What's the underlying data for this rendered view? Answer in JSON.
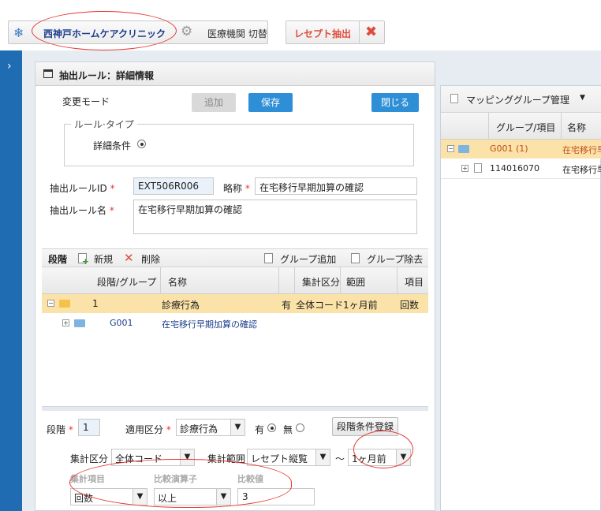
{
  "topbar": {
    "clinic_name": "西神戸ホームケアクリニック",
    "switch_label": "医療機関 切替",
    "receipt_label": "レセプト抽出"
  },
  "panel_title": "抽出ルール：詳細情報",
  "form": {
    "mode_label": "変更モード",
    "add_label": "追加",
    "save_label": "保存",
    "close_label": "閉じる",
    "rule_type_legend": "ルール·タイプ",
    "detail_condition_label": "詳細条件",
    "rule_id_label": "抽出ルールID",
    "rule_id_value": "EXT506R006",
    "short_name_label": "略称",
    "short_name_value": "在宅移行早期加算の確認",
    "rule_name_label": "抽出ルール名",
    "rule_name_value": "在宅移行早期加算の確認",
    "required_mark": "*"
  },
  "stage_toolbar": {
    "title": "段階",
    "new_label": "新規",
    "delete_label": "削除",
    "group_add_label": "グループ追加",
    "group_remove_label": "グループ除去"
  },
  "stage_grid": {
    "headers": [
      "段階/グループ",
      "名称",
      "",
      "集計区分",
      "範囲",
      "項目"
    ],
    "rows": [
      {
        "stage": "1",
        "name": "診療行為",
        "flag": "有",
        "agg": "全体コード",
        "range": "1ヶ月前",
        "item": "回数"
      },
      {
        "stage": "G001",
        "name": "在宅移行早期加算の確認",
        "flag": "",
        "agg": "",
        "range": "",
        "item": ""
      }
    ]
  },
  "stage_form": {
    "stage_label": "段階",
    "stage_value": "1",
    "apply_label": "適用区分",
    "apply_value": "診療行為",
    "yes_label": "有",
    "no_label": "無",
    "register_label": "段階条件登録",
    "agg_label": "集計区分",
    "agg_value": "全体コード",
    "range_label": "集計範囲",
    "range_value": "レセプト縦覧",
    "tilde": "～",
    "range_to_value": "1ヶ月前",
    "item_header": "集計項目",
    "op_header": "比較演算子",
    "cmp_header": "比較値",
    "item_value": "回数",
    "op_value": "以上",
    "cmp_value": "3"
  },
  "mapping": {
    "toolbar_label": "マッピンググループ管理",
    "headers": [
      "グループ/項目",
      "名称"
    ],
    "rows": [
      {
        "code": "G001 (1)",
        "name": "在宅移行早"
      },
      {
        "code": "114016070",
        "name": "在宅移行早"
      }
    ]
  },
  "colors": {
    "accent_blue": "#2e8fd7",
    "left_strip": "#1f6cb3",
    "selected_row": "#fbe2a8",
    "annotation_red": "#e53935"
  }
}
